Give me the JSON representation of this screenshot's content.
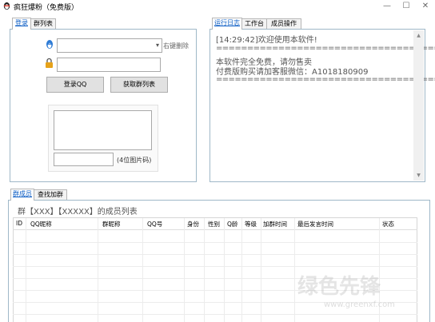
{
  "window": {
    "title": "疯狂爆粉（免费版）",
    "minimize": "—",
    "maximize": "☐",
    "close": "✕"
  },
  "login_tabs": [
    "登录",
    "群列表"
  ],
  "login": {
    "account_hint": "右键删除",
    "login_button": "登录QQ",
    "get_groups_button": "获取群列表",
    "captcha_hint": "(4位图片码)"
  },
  "log_tabs": [
    "运行日志",
    "工作台",
    "成员操作"
  ],
  "log": {
    "lines": [
      "[14:29:42]欢迎使用本软件!",
      "====================================",
      "本软件完全免费，请勿售卖",
      "付费版购买请加客服微信：A1018180909",
      "===================================="
    ]
  },
  "member_tabs": [
    "群成员",
    "查找加群"
  ],
  "members": {
    "caption": "群【XXX】【XXXXX】的成员列表",
    "columns": [
      "ID",
      "QQ昵称",
      "群昵称",
      "QQ号",
      "身份",
      "性别",
      "Q龄",
      "等级",
      "加群时间",
      "最后发言时间",
      "状态"
    ],
    "rows": []
  },
  "watermark": {
    "text": "绿色先锋",
    "url": "www.greenxf.com"
  },
  "colors": {
    "accent": "#0b5cc4",
    "panel_border": "#9fb8c8",
    "qq_icon": "#2d7bd6",
    "lock_icon": "#e6a21a"
  }
}
